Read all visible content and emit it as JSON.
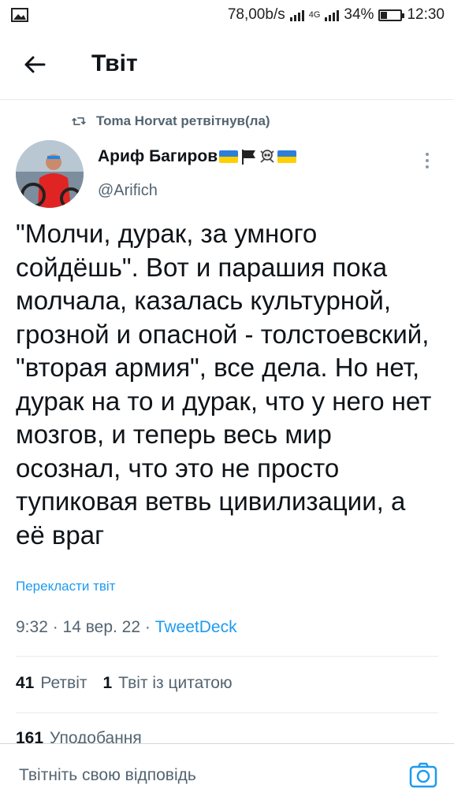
{
  "status_bar": {
    "speed": "78,00b/s",
    "network_label": "4G",
    "battery": "34%",
    "battery_level": 0.34,
    "time": "12:30"
  },
  "header": {
    "title": "Твіт",
    "back_icon": "arrow-left-icon"
  },
  "retweet": {
    "icon": "retweet-icon",
    "text": "Toma Horvat ретвітнув(ла)"
  },
  "author": {
    "name": "Ариф Багиров",
    "name_emoji": [
      "flag-ukraine",
      "flag-black",
      "skull-crossbones",
      "flag-ukraine"
    ],
    "handle": "@Arifich"
  },
  "tweet": {
    "text": "\"Молчи, дурак, за умного сойдёшь\". Вот и парашия пока молчала, казалась культурной, грозной и опасной - толстоевский, \"вторая армия\", все дела. Но нет, дурак на то и дурак, что у него нет мозгов, и теперь весь мир осознал, что это не просто тупиковая ветвь цивилизации, а её враг",
    "translate": "Перекласти твіт",
    "time": "9:32 · 14 вер. 22 · ",
    "source": "TweetDeck"
  },
  "stats": {
    "retweets_count": "41",
    "retweets_label": "Ретвіт",
    "quotes_count": "1",
    "quotes_label": "Твіт із цитатою",
    "likes_count": "161",
    "likes_label": "Уподобання"
  },
  "reply": {
    "placeholder": "Твітніть свою відповідь",
    "camera_icon": "camera-icon"
  },
  "colors": {
    "accent": "#1d9bf0",
    "secondary_text": "#536471",
    "primary_text": "#0f1419"
  }
}
